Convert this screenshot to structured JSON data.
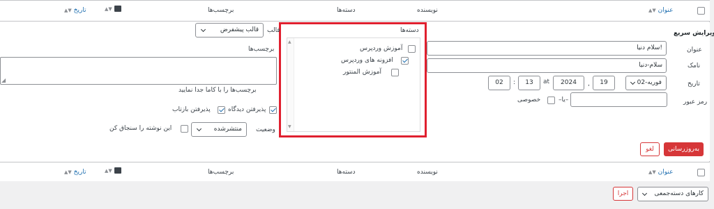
{
  "columns": {
    "title": "عنوان",
    "author": "نویسنده",
    "categories": "دسته‌ها",
    "tags": "برچسب‌ها",
    "date": "تاریخ",
    "comments_icon": "speech-bubble-icon"
  },
  "quick_edit": {
    "heading": "ویرایش سریع",
    "title_label": "عنوان",
    "title_value": "سلام دنیا!",
    "slug_label": "نامک",
    "slug_value": "سلام-دنیا",
    "date_label": "تاریخ",
    "date_month": "02-فوریه",
    "date_day": "19",
    "date_year": "2024",
    "date_at": "at",
    "date_hour": "13",
    "date_minute": "02",
    "password_label": "رمز عبور",
    "password_sep": "–یا–",
    "private_label": "خصوصی",
    "categories_label": "دسته‌ها",
    "categories": [
      {
        "label": "آموزش وردپرس",
        "checked": false
      },
      {
        "label": "افزونه های وردپرس",
        "checked": true
      },
      {
        "label": "آموزش المنتور",
        "checked": false
      }
    ],
    "template_label": "قالب",
    "template_value": "قالب پیشفرض",
    "tags_label": "برچسب‌ها",
    "tags_hint": "برچسب‌ها را با کاما جدا نمایید",
    "allow_comments": "پذیرفتن دیدگاه",
    "allow_pings": "پذیرفتن بازتاب",
    "status_label": "وضعیت",
    "status_value": "منتشرشده",
    "sticky_label": "این نوشته را سنجاق کن",
    "update_button": "به‌روزرسانی",
    "cancel_button": "لغو"
  },
  "bulk": {
    "action_value": "کارهای دسته‌جمعی",
    "apply_button": "اجرا"
  },
  "colors": {
    "highlight": "#e0202f",
    "accent": "#2271b1",
    "danger": "#d63638"
  }
}
